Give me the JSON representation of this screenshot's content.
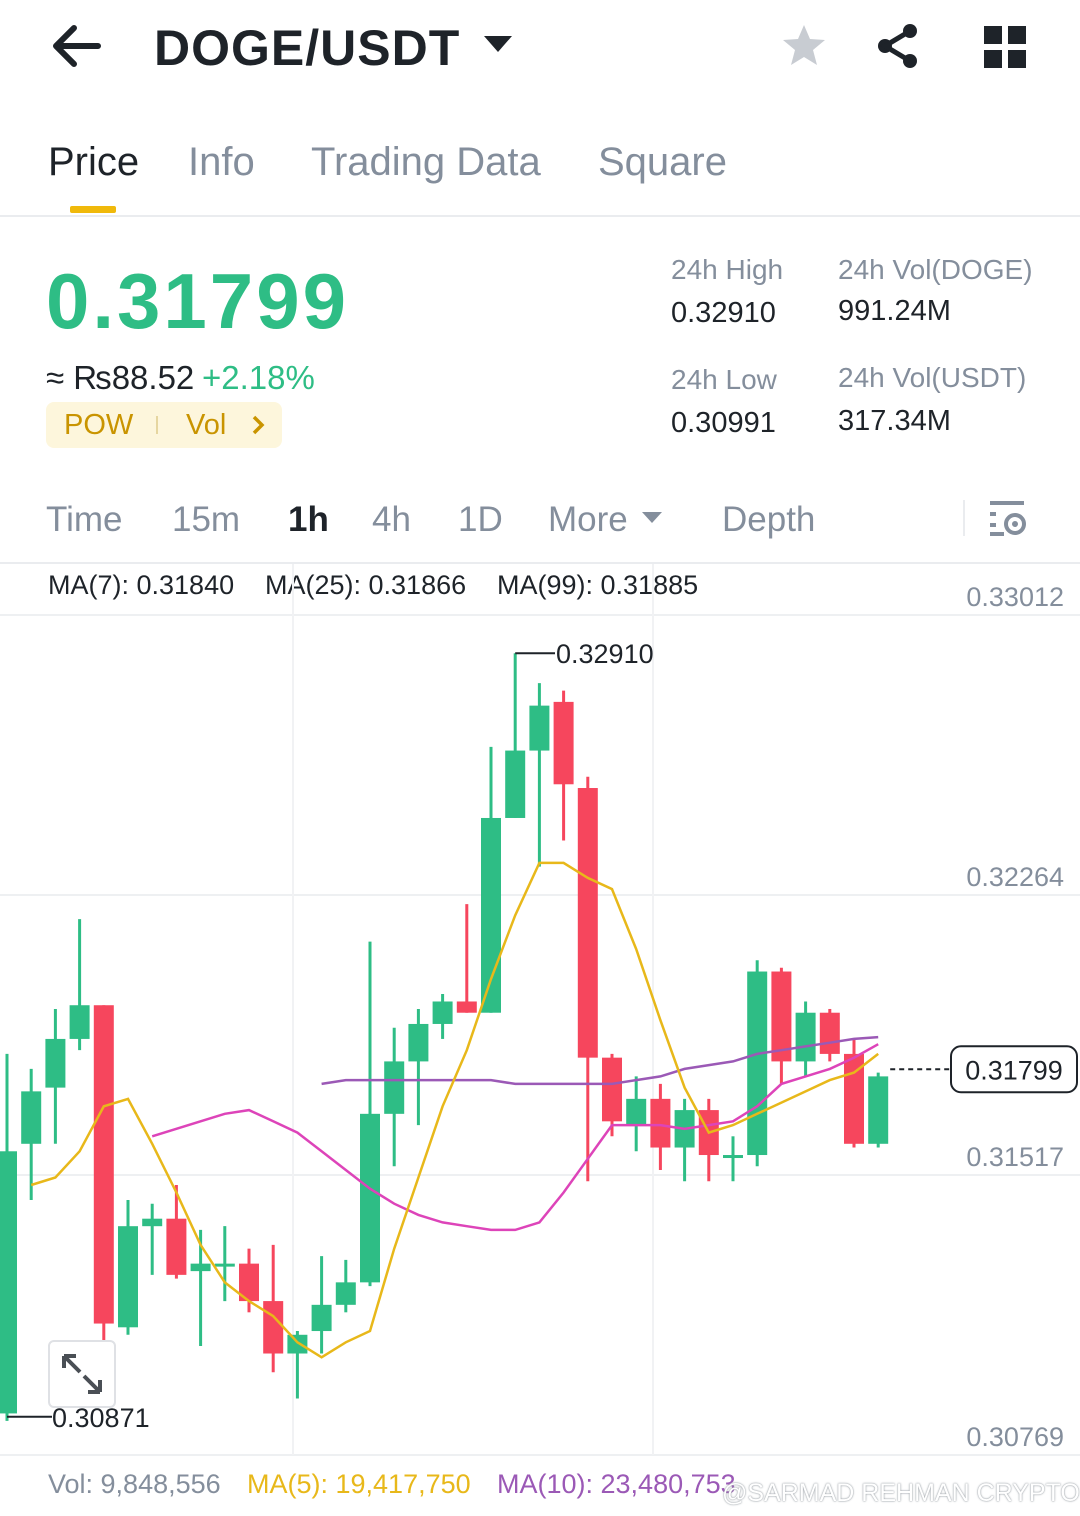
{
  "header": {
    "pair": "DOGE/USDT"
  },
  "tabs": [
    {
      "label": "Price"
    },
    {
      "label": "Info"
    },
    {
      "label": "Trading Data"
    },
    {
      "label": "Square"
    }
  ],
  "ticker": {
    "last_price": "0.31799",
    "approx": "≈ ₨88.52",
    "change": "+2.18%",
    "tag1": "POW",
    "tag2": "Vol",
    "high_label": "24h High",
    "high_value": "0.32910",
    "low_label": "24h Low",
    "low_value": "0.30991",
    "vol_doge_label": "24h Vol(DOGE)",
    "vol_doge_value": "991.24M",
    "vol_usdt_label": "24h Vol(USDT)",
    "vol_usdt_value": "317.34M"
  },
  "intervals": [
    {
      "label": "Time",
      "active": false
    },
    {
      "label": "15m",
      "active": false
    },
    {
      "label": "1h",
      "active": true
    },
    {
      "label": "4h",
      "active": false
    },
    {
      "label": "1D",
      "active": false
    },
    {
      "label": "More",
      "active": false
    },
    {
      "label": "Depth",
      "active": false
    }
  ],
  "ma_indicators": [
    {
      "label": "MA(7): 0.31840",
      "color": "#e8b81a"
    },
    {
      "label": "MA(25): 0.31866",
      "color": "#dd44b9"
    },
    {
      "label": "MA(99): 0.31885",
      "color": "#9b59b6"
    }
  ],
  "volume_indicators": [
    {
      "label": "Vol: 9,848,556",
      "color": "#848e9c"
    },
    {
      "label": "MA(5): 19,417,750",
      "color": "#e8b81a"
    },
    {
      "label": "MA(10): 23,480,753",
      "color": "#9b59b6"
    }
  ],
  "watermark": "@SARMAD REHMAN CRYPTO",
  "colors": {
    "up": "#2ebd85",
    "down": "#f6465d",
    "accent": "#f0b90b",
    "ma7": "#e8b81a",
    "ma25": "#dd44b9",
    "ma99": "#9b59b6"
  },
  "chart_data": {
    "type": "candlestick",
    "interval": "1h",
    "y_axis_labels": [
      "0.33012",
      "0.32264",
      "0.31517",
      "0.30769"
    ],
    "y_axis_values": [
      0.33012,
      0.32264,
      0.31517,
      0.30769
    ],
    "current_price_label": "0.31799",
    "high_marker": "0.32910",
    "low_marker": "0.30871",
    "candles": [
      {
        "o": 0.3088,
        "h": 0.3184,
        "l": 0.3086,
        "c": 0.3158
      },
      {
        "o": 0.316,
        "h": 0.318,
        "l": 0.3145,
        "c": 0.3174
      },
      {
        "o": 0.3175,
        "h": 0.3196,
        "l": 0.316,
        "c": 0.3188
      },
      {
        "o": 0.3188,
        "h": 0.322,
        "l": 0.3185,
        "c": 0.3197
      },
      {
        "o": 0.3197,
        "h": 0.3197,
        "l": 0.3107,
        "c": 0.3112
      },
      {
        "o": 0.3111,
        "h": 0.3145,
        "l": 0.3109,
        "c": 0.3138
      },
      {
        "o": 0.3138,
        "h": 0.3144,
        "l": 0.3125,
        "c": 0.314
      },
      {
        "o": 0.314,
        "h": 0.3149,
        "l": 0.3124,
        "c": 0.3125
      },
      {
        "o": 0.3126,
        "h": 0.3137,
        "l": 0.3106,
        "c": 0.3128
      },
      {
        "o": 0.3128,
        "h": 0.3138,
        "l": 0.3118,
        "c": 0.3128
      },
      {
        "o": 0.3128,
        "h": 0.3132,
        "l": 0.3115,
        "c": 0.3118
      },
      {
        "o": 0.3118,
        "h": 0.3133,
        "l": 0.3099,
        "c": 0.3104
      },
      {
        "o": 0.3104,
        "h": 0.311,
        "l": 0.3092,
        "c": 0.3109
      },
      {
        "o": 0.311,
        "h": 0.313,
        "l": 0.3104,
        "c": 0.3117
      },
      {
        "o": 0.3117,
        "h": 0.3129,
        "l": 0.3115,
        "c": 0.3123
      },
      {
        "o": 0.3123,
        "h": 0.3214,
        "l": 0.3122,
        "c": 0.3168
      },
      {
        "o": 0.3168,
        "h": 0.3191,
        "l": 0.3154,
        "c": 0.3182
      },
      {
        "o": 0.3182,
        "h": 0.3196,
        "l": 0.3165,
        "c": 0.3192
      },
      {
        "o": 0.3192,
        "h": 0.32,
        "l": 0.3188,
        "c": 0.3198
      },
      {
        "o": 0.3198,
        "h": 0.3224,
        "l": 0.3195,
        "c": 0.3195
      },
      {
        "o": 0.3195,
        "h": 0.3266,
        "l": 0.3195,
        "c": 0.3247
      },
      {
        "o": 0.3247,
        "h": 0.3291,
        "l": 0.3247,
        "c": 0.3265
      },
      {
        "o": 0.3265,
        "h": 0.3283,
        "l": 0.3234,
        "c": 0.3277
      },
      {
        "o": 0.3278,
        "h": 0.3281,
        "l": 0.3241,
        "c": 0.3256
      },
      {
        "o": 0.3255,
        "h": 0.3258,
        "l": 0.315,
        "c": 0.3183
      },
      {
        "o": 0.3183,
        "h": 0.3184,
        "l": 0.3162,
        "c": 0.3166
      },
      {
        "o": 0.3165,
        "h": 0.3178,
        "l": 0.3158,
        "c": 0.3172
      },
      {
        "o": 0.3172,
        "h": 0.3176,
        "l": 0.3153,
        "c": 0.3159
      },
      {
        "o": 0.3159,
        "h": 0.3172,
        "l": 0.315,
        "c": 0.3169
      },
      {
        "o": 0.3169,
        "h": 0.3172,
        "l": 0.315,
        "c": 0.3157
      },
      {
        "o": 0.3157,
        "h": 0.3162,
        "l": 0.315,
        "c": 0.3157
      },
      {
        "o": 0.3157,
        "h": 0.3209,
        "l": 0.3154,
        "c": 0.3206
      },
      {
        "o": 0.3206,
        "h": 0.3207,
        "l": 0.3176,
        "c": 0.3182
      },
      {
        "o": 0.3182,
        "h": 0.3198,
        "l": 0.3178,
        "c": 0.3195
      },
      {
        "o": 0.3195,
        "h": 0.3196,
        "l": 0.3182,
        "c": 0.3184
      },
      {
        "o": 0.3184,
        "h": 0.3188,
        "l": 0.3159,
        "c": 0.316
      },
      {
        "o": 0.316,
        "h": 0.3179,
        "l": 0.3159,
        "c": 0.3178
      }
    ],
    "ma7_series": [
      0.3149,
      0.3151,
      0.3158,
      0.317,
      0.3172,
      0.316,
      0.3147,
      0.3133,
      0.3123,
      0.3118,
      0.3114,
      0.3107,
      0.3103,
      0.3107,
      0.311,
      0.3132,
      0.3151,
      0.317,
      0.3185,
      0.3204,
      0.3221,
      0.3235,
      0.3235,
      0.3231,
      0.3228,
      0.3212,
      0.3193,
      0.3175,
      0.3163,
      0.3165,
      0.3168,
      0.3171,
      0.3174,
      0.3177,
      0.3179,
      0.3184
    ],
    "ma25_series": [
      0.3162,
      0.3164,
      0.3166,
      0.3168,
      0.3169,
      0.3166,
      0.3163,
      0.3158,
      0.3153,
      0.3148,
      0.3144,
      0.3141,
      0.3139,
      0.3138,
      0.3137,
      0.3137,
      0.3139,
      0.3147,
      0.3156,
      0.3165,
      0.3165,
      0.3165,
      0.3164,
      0.3165,
      0.3166,
      0.317,
      0.3176,
      0.3178,
      0.318,
      0.3183,
      0.31866
    ],
    "ma99_series": [
      0.3176,
      0.3177,
      0.3177,
      0.3177,
      0.3177,
      0.3177,
      0.3177,
      0.3177,
      0.3176,
      0.3176,
      0.3176,
      0.3176,
      0.3176,
      0.3177,
      0.3178,
      0.318,
      0.3181,
      0.3182,
      0.3184,
      0.3185,
      0.3186,
      0.3187,
      0.3188,
      0.31885
    ]
  }
}
